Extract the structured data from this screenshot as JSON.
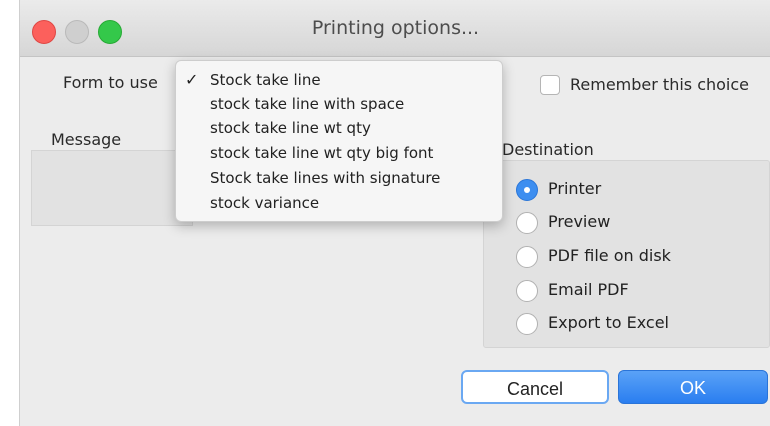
{
  "window": {
    "title": "Printing options..."
  },
  "form": {
    "label": "Form to use",
    "selected_index": 0,
    "options": [
      "Stock take line",
      "stock take line with space",
      "stock take line wt qty",
      "stock take line wt qty big font",
      "Stock take lines with signature",
      "stock variance"
    ]
  },
  "remember": {
    "label": "Remember this choice",
    "checked": false
  },
  "message": {
    "label": "Message"
  },
  "destination": {
    "label": "Destination",
    "selected": "Printer",
    "options": [
      "Printer",
      "Preview",
      "PDF file on disk",
      "Email PDF",
      "Export to Excel"
    ]
  },
  "buttons": {
    "cancel": "Cancel",
    "ok": "OK"
  },
  "icons": {
    "checkmark": "✓"
  },
  "colors": {
    "accent": "#3d8ef0",
    "close": "#fc605c",
    "zoom": "#34c84a"
  }
}
